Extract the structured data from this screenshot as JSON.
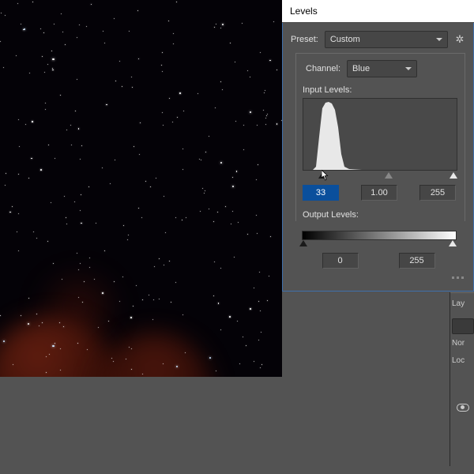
{
  "dialog": {
    "title": "Levels",
    "preset_label": "Preset:",
    "preset_value": "Custom",
    "channel_label": "Channel:",
    "channel_value": "Blue",
    "input_levels_label": "Input Levels:",
    "input": {
      "black": "33",
      "mid": "1.00",
      "white": "255"
    },
    "output_levels_label": "Output Levels:",
    "output": {
      "black": "0",
      "white": "255"
    }
  },
  "right_sidebar": {
    "layers_label": "Lay",
    "lock_label": "Loc",
    "normal_label": "Nor"
  },
  "icons": {
    "gear": "gear-icon",
    "dropdown": "chevron-down-icon",
    "cursor": "pointer-cursor",
    "eye": "eye-icon"
  }
}
